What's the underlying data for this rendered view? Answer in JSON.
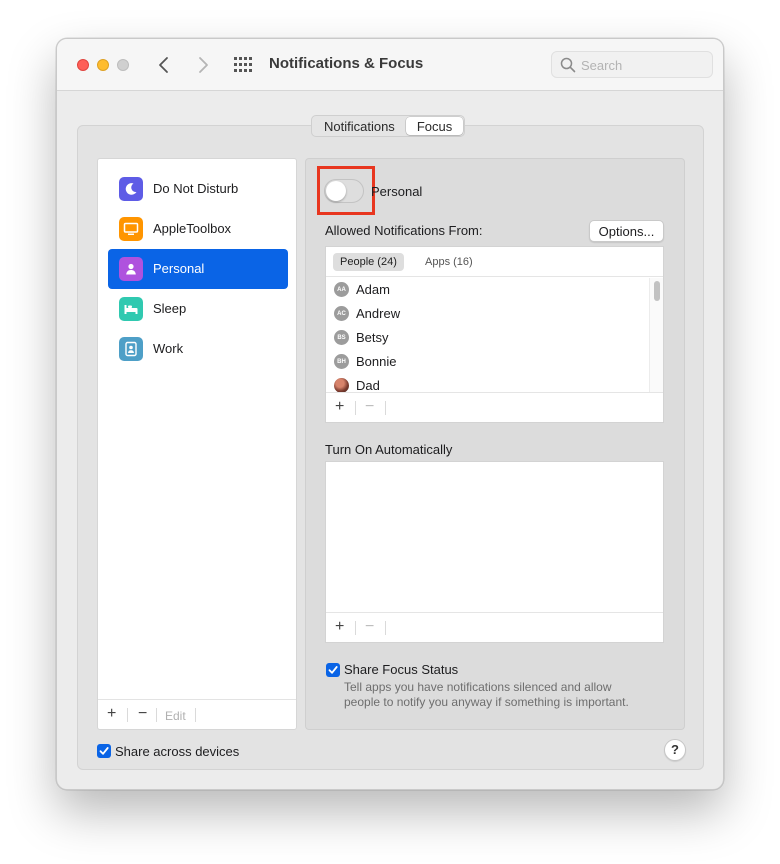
{
  "window": {
    "title": "Notifications & Focus",
    "search_placeholder": "Search"
  },
  "tabs": [
    {
      "label": "Notifications",
      "active": false
    },
    {
      "label": "Focus",
      "active": true
    }
  ],
  "sidebar": {
    "items": [
      {
        "label": "Do Not Disturb",
        "icon": "moon-icon",
        "color": "#5e5ce6"
      },
      {
        "label": "AppleToolbox",
        "icon": "monitor-icon",
        "color": "#ff9500"
      },
      {
        "label": "Personal",
        "icon": "person-icon",
        "color": "#af52de",
        "selected": true
      },
      {
        "label": "Sleep",
        "icon": "bed-icon",
        "color": "#30c9b0"
      },
      {
        "label": "Work",
        "icon": "badge-icon",
        "color": "#4e9fc7"
      }
    ],
    "footer": {
      "add": "+",
      "remove": "−",
      "edit": "Edit"
    }
  },
  "focus": {
    "toggle_on": false,
    "name": "Personal",
    "allowed_label": "Allowed Notifications From:",
    "options_label": "Options...",
    "people_tab": "People (24)",
    "apps_tab": "Apps (16)",
    "people": [
      {
        "initials": "AA",
        "name": "Adam"
      },
      {
        "initials": "AC",
        "name": "Andrew"
      },
      {
        "initials": "BS",
        "name": "Betsy"
      },
      {
        "initials": "BH",
        "name": "Bonnie"
      },
      {
        "initials": "",
        "name": "Dad"
      }
    ],
    "list_add": "+",
    "list_remove": "−",
    "turn_on_label": "Turn On Automatically",
    "share_status_label": "Share Focus Status",
    "share_status_checked": true,
    "share_status_desc_line1": "Tell apps you have notifications silenced and allow",
    "share_status_desc_line2": "people to notify you anyway if something is important."
  },
  "footer": {
    "share_devices_label": "Share across devices",
    "share_devices_checked": true,
    "help": "?"
  },
  "colors": {
    "accent": "#0a64e6",
    "highlight": "#e8361f"
  }
}
